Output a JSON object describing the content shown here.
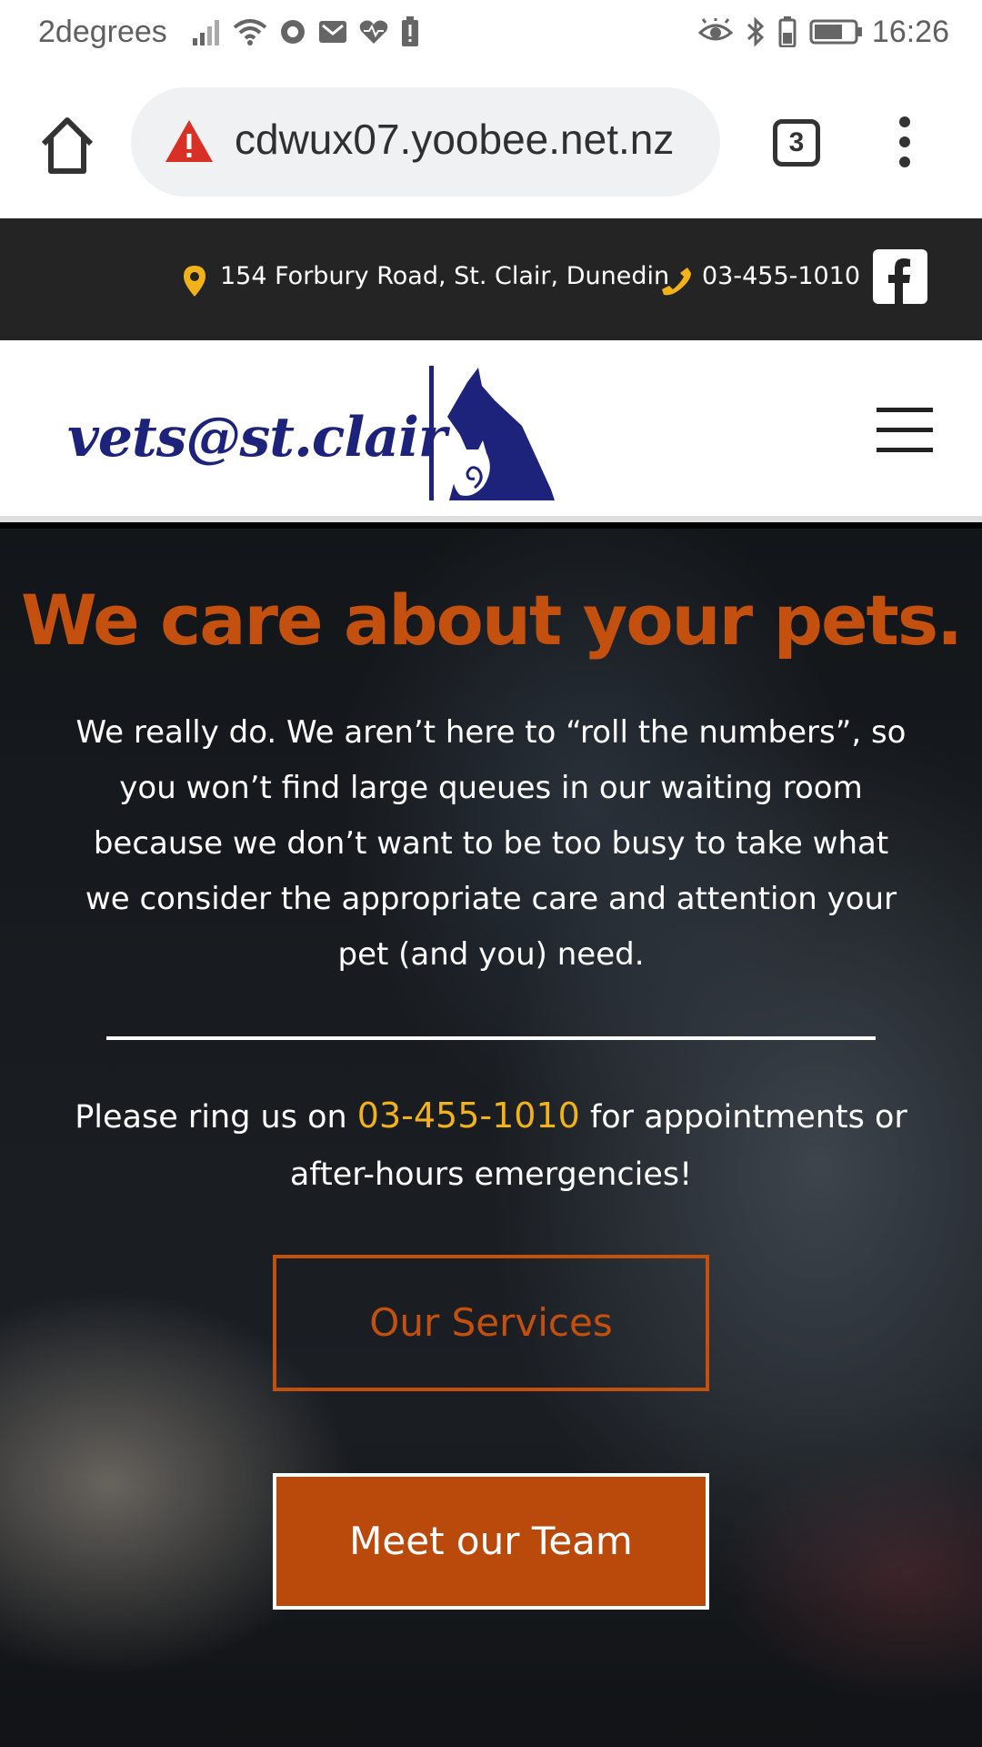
{
  "status_bar": {
    "carrier": "2degrees",
    "time": "16:26",
    "left_icons": [
      "signal-icon",
      "wifi-icon",
      "record-icon",
      "gmail-icon",
      "heart-monitor-icon",
      "battery-alert-icon"
    ],
    "right_icons": [
      "eye-comfort-icon",
      "bluetooth-icon",
      "battery-icon"
    ]
  },
  "browser": {
    "url": "cdwux07.yoobee.net.nz",
    "tab_count": "3",
    "security_icon": "warning-icon"
  },
  "info_bar": {
    "address": "154 Forbury Road, St. Clair, Dunedin",
    "phone": "03-455-1010",
    "colors": {
      "background": "#242424",
      "icon": "#f2b21a"
    }
  },
  "header": {
    "logo_text": "vets@st.clair",
    "logo_color": "#1d237a"
  },
  "hero": {
    "title": "We care about your pets.",
    "intro": "We really do. We aren’t here to “roll the numbers”, so you won’t find large queues in our waiting room because we don’t want to be too busy to take what we consider the appropriate care and attention your pet (and you) need.",
    "ring_before": "Please ring us on ",
    "ring_number": "03-455-1010",
    "ring_after": " for appointments or after-hours emergencies!",
    "services_button": "Our Services",
    "team_button": "Meet our Team",
    "colors": {
      "accent": "#c4500f",
      "highlight": "#f2b21a"
    }
  }
}
